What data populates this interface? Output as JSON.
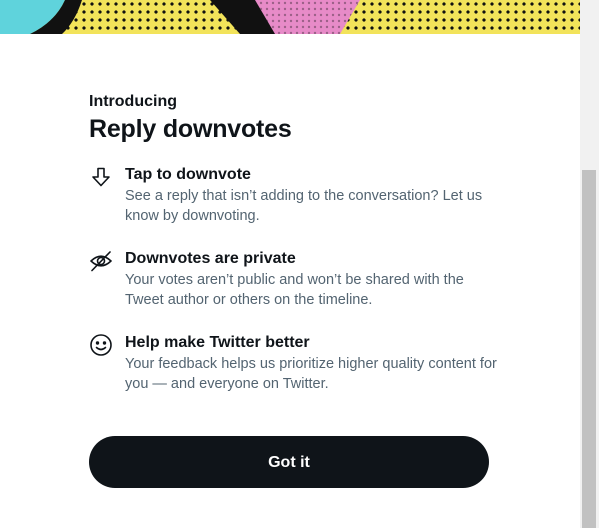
{
  "dialog": {
    "eyebrow": "Introducing",
    "title": "Reply downvotes",
    "features": [
      {
        "icon": "downvote-arrow-icon",
        "title": "Tap to downvote",
        "description": "See a reply that isn’t adding to the conversation? Let us know by downvoting."
      },
      {
        "icon": "eye-slash-icon",
        "title": "Downvotes are private",
        "description": "Your votes aren’t public and won’t be shared with the Tweet author or others on the timeline."
      },
      {
        "icon": "smiley-face-icon",
        "title": "Help make Twitter better",
        "description": "Your feedback helps us prioritize higher quality content for you — and everyone on Twitter."
      }
    ],
    "button_label": "Got it"
  },
  "colors": {
    "text_primary": "#0f1419",
    "text_secondary": "#536471",
    "button_bg": "#0f1419",
    "hero_yellow": "#f2e35a",
    "hero_cyan": "#5fd3dc",
    "hero_pink": "#e78bc8"
  }
}
